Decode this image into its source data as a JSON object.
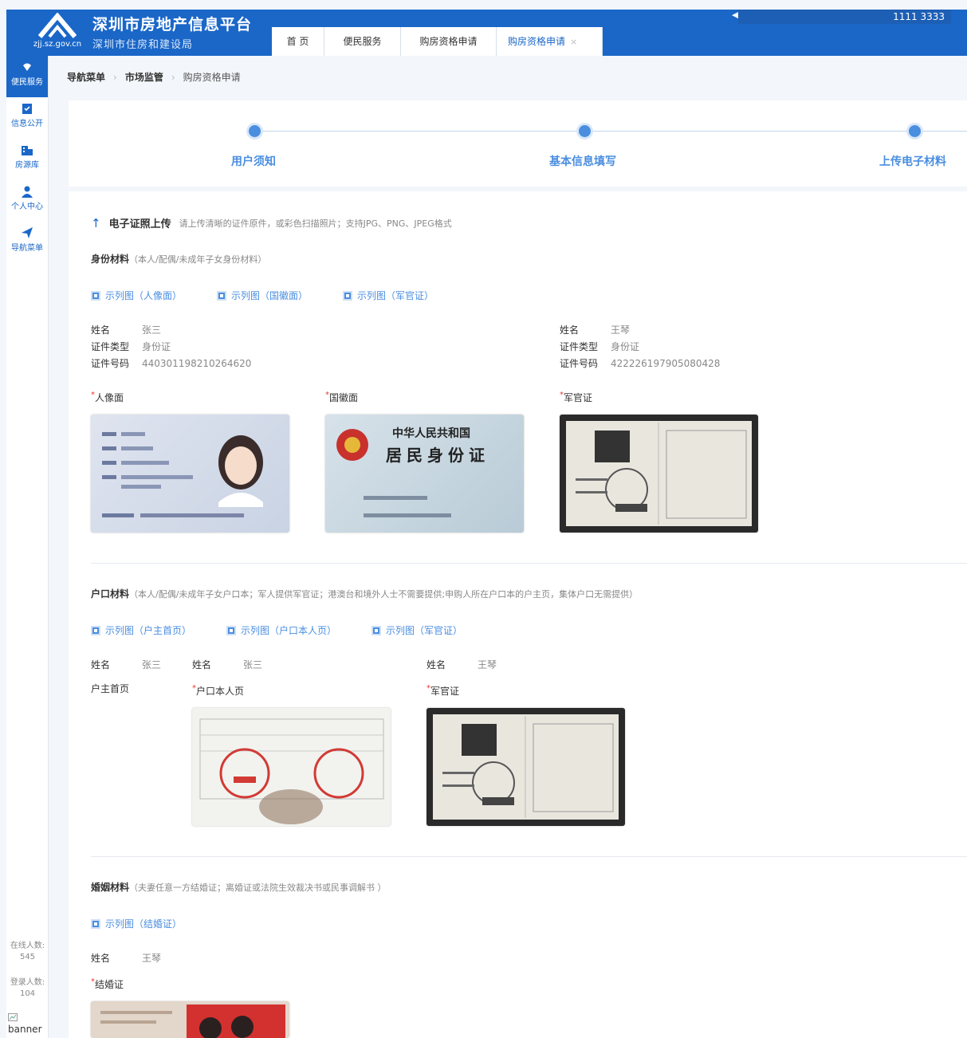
{
  "header": {
    "domain": "zjj.sz.gov.cn",
    "title": "深圳市房地产信息平台",
    "subtitle": "深圳市住房和建设局",
    "ticker": "1111  3333",
    "tabs": [
      {
        "label": "首 页"
      },
      {
        "label": "便民服务"
      },
      {
        "label": "购房资格申请"
      },
      {
        "label": "购房资格申请",
        "close": "×"
      }
    ]
  },
  "sidebar": {
    "items": [
      {
        "label": "便民服务",
        "icon": "hand-icon"
      },
      {
        "label": "信息公开",
        "icon": "clipboard-icon"
      },
      {
        "label": "房源库",
        "icon": "building-icon"
      },
      {
        "label": "个人中心",
        "icon": "person-icon"
      },
      {
        "label": "导航菜单",
        "icon": "send-icon"
      }
    ],
    "online_label": "在线人数:",
    "online_value": "545",
    "login_label": "登录人数:",
    "login_value": "104",
    "banner_alt": "banner"
  },
  "breadcrumb": [
    "导航菜单",
    "市场监管",
    "购房资格申请"
  ],
  "steps": [
    "用户须知",
    "基本信息填写",
    "上传电子材料"
  ],
  "upload": {
    "title": "电子证照上传",
    "note": "请上传清晰的证件原件，或彩色扫描照片；支持JPG、PNG、JPEG格式"
  },
  "identity": {
    "title": "身份材料",
    "note": "（本人/配偶/未成年子女身份材料）",
    "examples": [
      "示列图（人像面）",
      "示列图（国徽面）",
      "示列图（军官证）"
    ],
    "person_a": {
      "name_k": "姓名",
      "name_v": "张三",
      "type_k": "证件类型",
      "type_v": "身份证",
      "no_k": "证件号码",
      "no_v": "440301198210264620"
    },
    "person_b": {
      "name_k": "姓名",
      "name_v": "王琴",
      "type_k": "证件类型",
      "type_v": "身份证",
      "no_k": "证件号码",
      "no_v": "422226197905080428"
    },
    "fields": [
      "人像面",
      "国徽面",
      "军官证"
    ]
  },
  "hukou": {
    "title": "户口材料",
    "note": "（本人/配偶/未成年子女户口本；军人提供军官证；港澳台和境外人士不需要提供;申购人所在户口本的户主页，集体户口无需提供）",
    "examples": [
      "示列图（户主首页）",
      "示列图（户口本人页）",
      "示列图（军官证）"
    ],
    "n1_k": "姓名",
    "n1_v": "张三",
    "n2_k": "姓名",
    "n2_v": "张三",
    "n3_k": "姓名",
    "n3_v": "王琴",
    "field_head": "户主首页",
    "field_self": "户口本人页",
    "field_mil": "军官证"
  },
  "marriage": {
    "title": "婚姻材料",
    "note": "（夫妻任意一方结婚证；离婚证或法院生效裁决书或民事调解书 ）",
    "examples": [
      "示列图（结婚证）"
    ],
    "name_k": "姓名",
    "name_v": "王琴",
    "field": "结婚证"
  },
  "card_text": {
    "id_back_line1": "中华人民共和国",
    "id_back_line2": "居民身份证"
  }
}
